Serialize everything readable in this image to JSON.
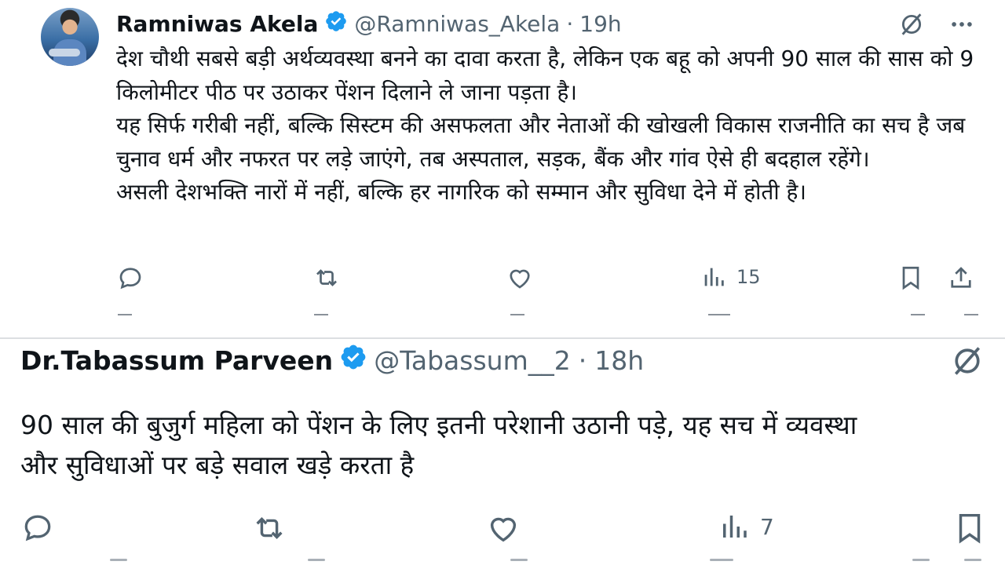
{
  "tweets": [
    {
      "author_name": "Ramniwas Akela",
      "handle": "@Ramniwas_Akela",
      "separator": "·",
      "time": "19h",
      "text": "देश चौथी सबसे बड़ी अर्थव्यवस्था बनने का दावा करता है, लेकिन एक बहू को अपनी 90 साल की सास को 9 किलोमीटर पीठ पर उठाकर पेंशन दिलाने ले जाना पड़ता है।\nयह सिर्फ गरीबी नहीं, बल्कि सिस्टम की असफलता और नेताओं की खोखली विकास राजनीति का सच है जब चुनाव धर्म और नफरत पर लड़े जाएंगे, तब अस्पताल, सड़क, बैंक और गांव ऐसे ही बदहाल रहेंगे।\nअसली देशभक्ति नारों में नहीं, बल्कि हर नागरिक को सम्मान और सुविधा देने में होती है।",
      "views": "15",
      "icons": [
        "reply-icon",
        "repost-icon",
        "like-icon",
        "views-icon",
        "bookmark-icon",
        "share-icon",
        "grok-icon",
        "more-icon",
        "verified-badge-icon"
      ]
    },
    {
      "author_name": "Dr.Tabassum Parveen",
      "handle": "@Tabassum__2",
      "separator": "·",
      "time": "18h",
      "text": "90 साल की बुजुर्ग महिला को पेंशन के लिए इतनी परेशानी उठानी पड़े, यह सच में व्यवस्था\nऔर सुविधाओं पर बड़े सवाल खड़े करता है",
      "views": "7",
      "icons": [
        "reply-icon",
        "repost-icon",
        "like-icon",
        "views-icon",
        "bookmark-icon",
        "grok-icon",
        "verified-badge-icon"
      ]
    }
  ],
  "colors": {
    "verified_blue": "#1d9bf0",
    "text": "#0f1419",
    "secondary": "#536471",
    "background": "#ffffff"
  }
}
